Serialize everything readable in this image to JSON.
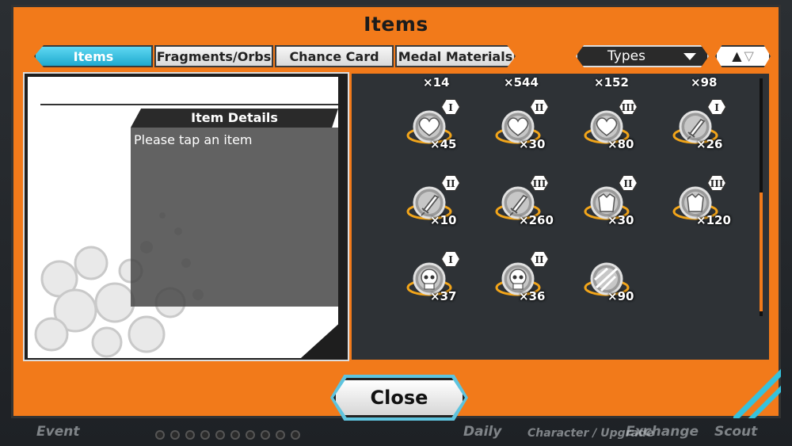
{
  "modal": {
    "title": "Items",
    "close_label": "Close"
  },
  "tabs": [
    {
      "label": "Items",
      "active": true
    },
    {
      "label": "Fragments/Orbs",
      "active": false
    },
    {
      "label": "Chance Card",
      "active": false
    },
    {
      "label": "Medal Materials",
      "active": false
    }
  ],
  "filter": {
    "types_label": "Types",
    "sort_icon": "up-down-arrows-icon"
  },
  "details": {
    "header": "Item Details",
    "placeholder": "Please tap an item"
  },
  "grid": {
    "top_row_counts": [
      "×14",
      "×544",
      "×152",
      "×98"
    ],
    "items": [
      {
        "icon": "heart-orb-icon",
        "rank": "I",
        "count": "×45"
      },
      {
        "icon": "heart-orb-icon",
        "rank": "II",
        "count": "×30"
      },
      {
        "icon": "heart-orb-icon",
        "rank": "III",
        "count": "×80"
      },
      {
        "icon": "sword-orb-icon",
        "rank": "I",
        "count": "×26"
      },
      {
        "icon": "sword-orb-icon",
        "rank": "II",
        "count": "×10"
      },
      {
        "icon": "sword-orb-icon",
        "rank": "III",
        "count": "×260"
      },
      {
        "icon": "armor-orb-icon",
        "rank": "II",
        "count": "×30"
      },
      {
        "icon": "armor-orb-icon",
        "rank": "III",
        "count": "×120"
      },
      {
        "icon": "skull-orb-icon",
        "rank": "I",
        "count": "×37"
      },
      {
        "icon": "skull-orb-icon",
        "rank": "II",
        "count": "×36"
      },
      {
        "icon": "shine-orb-icon",
        "rank": "",
        "count": "×90"
      }
    ]
  },
  "background_nav": {
    "labels": [
      "Event",
      "Daily",
      "Character / Upgrade",
      "Exchange",
      "Scout"
    ]
  },
  "colors": {
    "accent_orange": "#f27a1a",
    "tab_active": "#1fa9cf",
    "close_glow": "#5fc4de"
  }
}
